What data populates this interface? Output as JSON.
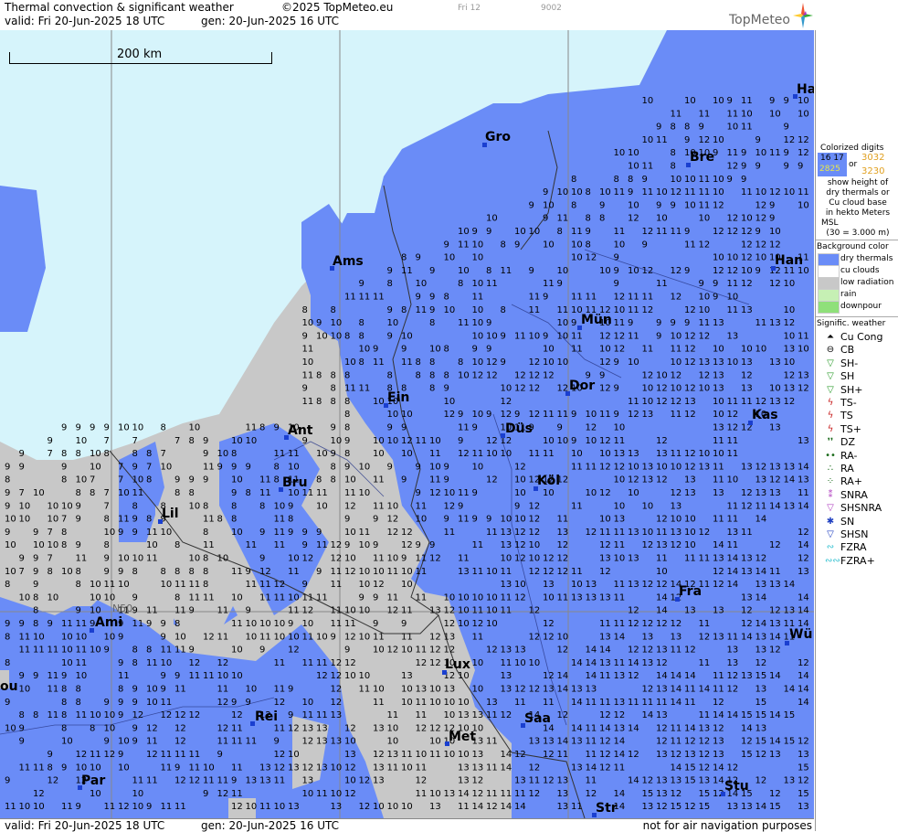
{
  "header": {
    "title": "Thermal convection & significant weather",
    "copyright": "©2025 TopMeteo.eu",
    "valid": "valid:  Fri  20-Jun-2025  18 UTC",
    "generated": "gen: 20-Jun-2025 16 UTC",
    "frame_label": "Fri 12",
    "frame_code": "9002",
    "brand": "TopMeteo"
  },
  "map": {
    "scale_label": "200 km",
    "latitude_label": "N50",
    "cities": [
      {
        "name": "Gro"
      },
      {
        "name": "Bre"
      },
      {
        "name": "Ha"
      },
      {
        "name": "Ams"
      },
      {
        "name": "Han"
      },
      {
        "name": "Mün"
      },
      {
        "name": "Ein"
      },
      {
        "name": "Dor"
      },
      {
        "name": "Kas"
      },
      {
        "name": "Ant"
      },
      {
        "name": "Düs"
      },
      {
        "name": "Bru"
      },
      {
        "name": "Köl"
      },
      {
        "name": "Lil"
      },
      {
        "name": "Fra"
      },
      {
        "name": "Ami"
      },
      {
        "name": "Wü"
      },
      {
        "name": "Lux"
      },
      {
        "name": "Rei"
      },
      {
        "name": "Saa"
      },
      {
        "name": "Met"
      },
      {
        "name": "Stu"
      },
      {
        "name": "Par"
      },
      {
        "name": "Str"
      },
      {
        "name": "ou"
      }
    ],
    "colors": {
      "sea": "#d6f4fb",
      "dry_thermals": "#6a8cf7",
      "low_radiation": "#c8c8c8",
      "border": "#333333",
      "grid": "#888888"
    }
  },
  "footer": {
    "valid": "valid:  Fri  20-Jun-2025  18 UTC",
    "generated": "gen: 20-Jun-2025 16 UTC",
    "disclaimer": "not for air navigation purposes"
  },
  "legend": {
    "colorized_title": "Colorized digits",
    "sample_a": "16 17",
    "sample_b": "2825",
    "sample_or": "or",
    "sample_c": "3032",
    "sample_d": "3230",
    "explanation": [
      "show height of",
      "dry thermals or",
      "Cu cloud base",
      "in hekto Meters",
      "MSL",
      "(30 = 3.000 m)"
    ],
    "background_title": "Background color",
    "background_items": [
      {
        "label": "dry thermals",
        "color": "#6a8cf7"
      },
      {
        "label": "cu clouds",
        "color": "#ffffff"
      },
      {
        "label": "low radiation",
        "color": "#c8c8c8"
      },
      {
        "label": "rain",
        "color": "#c6f0b4"
      },
      {
        "label": "downpour",
        "color": "#8fe07a"
      }
    ],
    "weather_title": "Signific. weather",
    "weather_items": [
      {
        "label": "Cu Cong",
        "icon": "cu-cong-icon",
        "glyph": "⏶",
        "color": "#000000"
      },
      {
        "label": "CB",
        "icon": "cb-icon",
        "glyph": "⊖",
        "color": "#000000"
      },
      {
        "label": "SH-",
        "icon": "shower-light-icon",
        "glyph": "▽",
        "color": "#2a9b2a"
      },
      {
        "label": "SH",
        "icon": "shower-icon",
        "glyph": "▽",
        "color": "#2a9b2a"
      },
      {
        "label": "SH+",
        "icon": "shower-heavy-icon",
        "glyph": "▽",
        "color": "#2a9b2a"
      },
      {
        "label": "TS-",
        "icon": "thunderstorm-light-icon",
        "glyph": "ϟ",
        "color": "#c82020"
      },
      {
        "label": "TS",
        "icon": "thunderstorm-icon",
        "glyph": "ϟ",
        "color": "#c82020"
      },
      {
        "label": "TS+",
        "icon": "thunderstorm-heavy-icon",
        "glyph": "ϟ",
        "color": "#c82020"
      },
      {
        "label": "DZ",
        "icon": "drizzle-icon",
        "glyph": "❜❜",
        "color": "#1a6a1a"
      },
      {
        "label": "RA-",
        "icon": "rain-light-icon",
        "glyph": "••",
        "color": "#1a6a1a"
      },
      {
        "label": "RA",
        "icon": "rain-icon",
        "glyph": "∴",
        "color": "#1a6a1a"
      },
      {
        "label": "RA+",
        "icon": "rain-heavy-icon",
        "glyph": "⁘",
        "color": "#1a6a1a"
      },
      {
        "label": "SNRA",
        "icon": "sleet-icon",
        "glyph": "⁑",
        "color": "#b040c0"
      },
      {
        "label": "SHSNRA",
        "icon": "sleet-shower-icon",
        "glyph": "▽",
        "color": "#b040c0"
      },
      {
        "label": "SN",
        "icon": "snow-icon",
        "glyph": "✱",
        "color": "#2040c0"
      },
      {
        "label": "SHSN",
        "icon": "snow-shower-icon",
        "glyph": "▽",
        "color": "#2040c0"
      },
      {
        "label": "FZRA",
        "icon": "freezing-rain-icon",
        "glyph": "∾",
        "color": "#30c0d0"
      },
      {
        "label": "FZRA+",
        "icon": "freezing-rain-heavy-icon",
        "glyph": "∾∾",
        "color": "#30c0d0"
      }
    ]
  }
}
